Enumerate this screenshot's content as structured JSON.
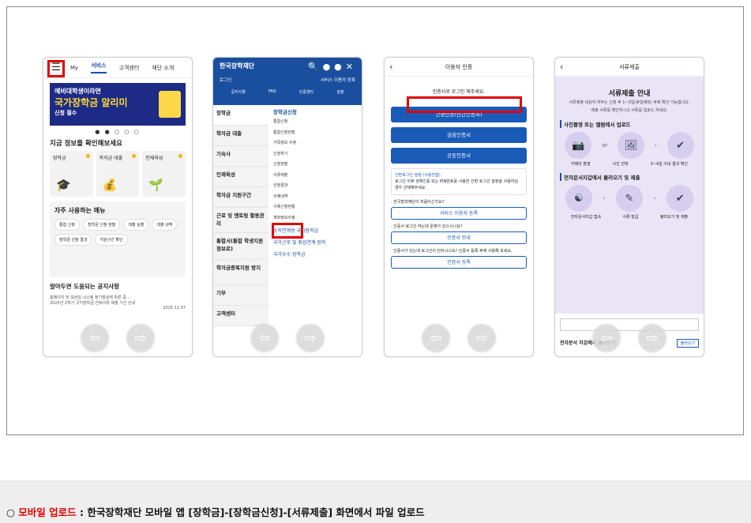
{
  "phone1": {
    "tabs": [
      "My",
      "서비스",
      "고객센터",
      "재단 소개"
    ],
    "banner": {
      "line1": "예비대학생이라면",
      "line2": "국가장학금 알리미",
      "line3": "신청 필수"
    },
    "dots": "● ● ○ ○ ○",
    "heading": "지금 정보를 확인해보세요",
    "cards": [
      "장학금",
      "학자금 대출",
      "인재육성"
    ],
    "freq_title": "자주 사용하는 메뉴",
    "chips": [
      "통합 신청",
      "장학금 신청 현황",
      "대출 실행",
      "대출 내역",
      "장학금 선정 결과",
      "지원구간 확인"
    ],
    "notice_title": "알아두면 도움되는 공지사항",
    "notice_line1": "홈페이지 및 모바일 시스템 정기점검에 따른 중...",
    "notice_line2": "2025년 2학기 국가장학금 선택서류 제출 기간 안내",
    "notice_date": "2025.11.07"
  },
  "phone2": {
    "logo": "한국장학재단",
    "login": "로그인",
    "register": "서비스 이용자 등록",
    "grid": [
      "공지사항",
      "FAQ",
      "인증센터",
      "설정"
    ],
    "left_menu": [
      "장학금",
      "학자금 대출",
      "기숙사",
      "인재육성",
      "학자금 지원구간",
      "근로 및 멘토링 활동관리",
      "통합서(통합 학생지원 정보로)",
      "학자금종복지원 방지",
      "기부",
      "고객센터"
    ],
    "right_title": "장학금신청",
    "right_items": [
      "통합신청",
      "통합신청현황",
      "가족정보 수정",
      "신청하기",
      "신청현황",
      "서류제출",
      "선정결과",
      "수혜내역",
      "구제신청현황",
      "계좌정보수정"
    ],
    "sub1": "소득연계형 국가장학금",
    "sub2": "국가근로 및 취업연계 장학",
    "sub3": "국가우수 장학금"
  },
  "phone3": {
    "title": "이용자 인증",
    "msg": "인증서로 로그인 해주세요.",
    "buttons": [
      "간편인증(민간인증서)",
      "금융인증서",
      "공동인증서"
    ],
    "card_title": "간편로그인 설정 (사용안함)",
    "card_text": "로그인 이후 생체인증 또는 PIN번호를 사용한 간편 로그인 설정을 사용하실 경우 선택해주세요.",
    "q1": "· 한국장학재단이 처음이신가요?",
    "btn1": "서비스 이용자 등록",
    "q2": "· 인증서 로그인 하는데 문제가 있으시나요?",
    "btn2": "인증서 안내",
    "q3": "· 인증서가 있는데 로그인이 안되시나요? 인증서 등록 후에 사용해 보세요.",
    "btn3": "인증서 등록"
  },
  "phone4": {
    "title": "서류제출",
    "heading": "서류제출 안내",
    "desc1": "서류제출 대상자 여부는 신청 후 1~3일(휴일제외) 후에 확인 가능합니다.",
    "desc2": "제출 서류를 확인하시고 서류를 업로드 하세요.",
    "sec1": "사진촬영 또는 앨범에서 업로드",
    "steps1": [
      "카메라 촬영",
      "사진 선택",
      "3~4일 이내 결과 확인"
    ],
    "or": "or",
    "sec2": "전자문서지갑에서 불러오기 및 제출",
    "steps2": [
      "전자문서지갑 접속",
      "서류 발급",
      "불러오기 및 제출"
    ],
    "bottom_label": "전자문서 지갑에서 불러오기",
    "bottom_btn": "불러오기"
  },
  "caption": {
    "prefix": "○ ",
    "highlight": "모바일 업로드",
    "rest": " : 한국장학재단 모바일 앱 [장학금]-[장학금신청]-[서류제출] 화면에서 파일 업로드"
  }
}
